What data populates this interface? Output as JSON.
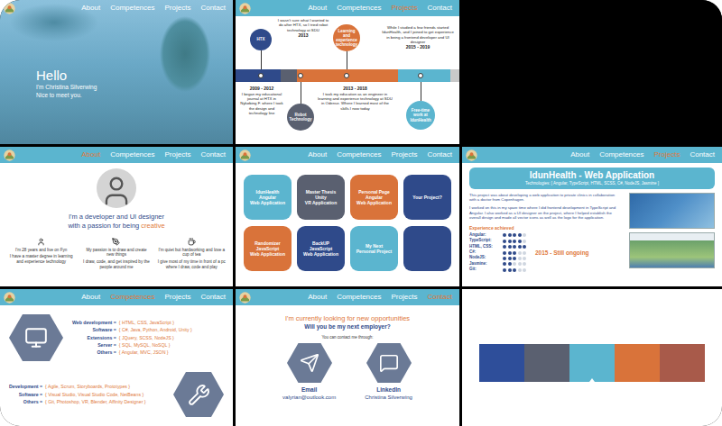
{
  "hero": {
    "nav": [
      {
        "label": "About",
        "selected": false
      },
      {
        "label": "Competences",
        "selected": false
      },
      {
        "label": "Projects",
        "selected": false
      },
      {
        "label": "Contact",
        "selected": false
      }
    ],
    "greeting": "Hello",
    "lines": [
      "I'm Christina Silverwing",
      "Nice to meet you."
    ]
  },
  "timeline": {
    "nav": [
      {
        "label": "About",
        "selected": false
      },
      {
        "label": "Competences",
        "selected": false
      },
      {
        "label": "Projects",
        "selected": true
      },
      {
        "label": "Contact",
        "selected": false
      }
    ],
    "segments": [
      {
        "color": "#2f4a8a"
      },
      {
        "color": "#5a6070"
      },
      {
        "color": "#d9733a"
      },
      {
        "color": "#5bb5cf"
      },
      {
        "color": "#c9c9c9"
      }
    ],
    "events": [
      {
        "kind": "circle",
        "label": "HTX",
        "color": "#2f4a8a"
      },
      {
        "kind": "note",
        "year": "2013",
        "text": "I wasn't sure what I wanted to do after HTX, so I tried robot technology at SDU"
      },
      {
        "kind": "circle",
        "label": "Learning and experience technology",
        "color": "#d9733a"
      },
      {
        "kind": "note",
        "year": "2015 - 2019",
        "text": "While I studied a few friends started IdunHealth, and I joined to get experience in being a frontend developer and UI designer"
      },
      {
        "kind": "note",
        "year": "2009 - 2012",
        "text": "I began my educational journal at HTX in Nykøbing F. where I took the design and technology line"
      },
      {
        "kind": "circle",
        "label": "Robot Technology",
        "color": "#5a6070"
      },
      {
        "kind": "note",
        "year": "2013 - 2018",
        "text": "I took my education as an engineer in learning and experience technology at SDU in Odense. Where I learned most of the skills I now today"
      },
      {
        "kind": "circle",
        "label": "Free-time work at IdunHealth",
        "color": "#5bb5cf"
      }
    ]
  },
  "about": {
    "nav": [
      {
        "label": "About",
        "selected": true
      },
      {
        "label": "Competences",
        "selected": false
      },
      {
        "label": "Projects",
        "selected": false
      },
      {
        "label": "Contact",
        "selected": false
      }
    ],
    "title": "I'm a developer and UI designer",
    "subtitle_prefix": "with a passion for being ",
    "subtitle_highlight": "creative",
    "facts": [
      {
        "headline": "I'm 28 years and live on Fyn",
        "detail": "I have a master degree in learning and experience technology"
      },
      {
        "headline": "My passion is to draw and create new things",
        "detail": "I draw, code, and get inspired by the people around me"
      },
      {
        "headline": "I'm quiet but hardworking and love a cup of tea",
        "detail": "I give most of my time in front of a pc where I draw, code and play"
      }
    ]
  },
  "projects": {
    "nav": [
      {
        "label": "About",
        "selected": false
      },
      {
        "label": "Competences",
        "selected": false
      },
      {
        "label": "Projects",
        "selected": false
      },
      {
        "label": "Contact",
        "selected": false
      }
    ],
    "tiles": [
      {
        "lines": [
          "IdunHealth",
          "Angular",
          "Web Application"
        ],
        "color": "#5bb5cf"
      },
      {
        "lines": [
          "Master Thesis",
          "Unity",
          "VR Application"
        ],
        "color": "#5a6070"
      },
      {
        "lines": [
          "Personal Page",
          "Angular",
          "Web Application"
        ],
        "color": "#d9733a"
      },
      {
        "lines": [
          "Your Project?"
        ],
        "color": "#2f4a8a"
      },
      {
        "lines": [
          "Randomizer",
          "JavaScript",
          "Web Application"
        ],
        "color": "#d9733a"
      },
      {
        "lines": [
          "BackUP",
          "JavaScript",
          "Web Application"
        ],
        "color": "#2f4a8a"
      },
      {
        "lines": [
          "My Next",
          "Personal Project"
        ],
        "color": "#5bb5cf"
      },
      {
        "lines": [],
        "color": "#2f4a8a"
      }
    ]
  },
  "project_detail": {
    "nav": [
      {
        "label": "About",
        "selected": false
      },
      {
        "label": "Competences",
        "selected": false
      },
      {
        "label": "Projects",
        "selected": true
      },
      {
        "label": "Contact",
        "selected": false
      }
    ],
    "title": "IdunHealth - Web Application",
    "technologies": "Technologies: [ Angular, TypeScript, HTML, SCSS, C#, NodeJS, Jasmine ]",
    "paragraphs": [
      "This project was about developing a web application to private clinics in collaboration with a doctor from Copenhagen.",
      "I worked on this in my spare time where I did frontend development in TypeScript and Angular. I also worked as a UI designer on the project, where I helped establish the overall design and made all vector icons as well as the logo for the application."
    ],
    "experience_title": "Experience achieved",
    "skills": [
      {
        "name": "Angular:",
        "stars": 4
      },
      {
        "name": "TypeScript:",
        "stars": 4
      },
      {
        "name": "HTML, CSS:",
        "stars": 5
      },
      {
        "name": "C#:",
        "stars": 3
      },
      {
        "name": "NodeJS:",
        "stars": 3
      },
      {
        "name": "Jasmine:",
        "stars": 2
      },
      {
        "name": "Git:",
        "stars": 3
      }
    ],
    "period": "2015 - Still ongoing"
  },
  "competences": {
    "nav": [
      {
        "label": "About",
        "selected": false
      },
      {
        "label": "Competences",
        "selected": true
      },
      {
        "label": "Projects",
        "selected": false
      },
      {
        "label": "Contact",
        "selected": false
      }
    ],
    "technical": [
      {
        "label": "Web development =",
        "value": "{ HTML, CSS, JavaScript }"
      },
      {
        "label": "Software =",
        "value": "{ C#, Java, Python, Android, Unity }"
      },
      {
        "label": "Extensions =",
        "value": "{ JQuery, SCSS, NodeJS }"
      },
      {
        "label": "Server =",
        "value": "{ SQL, MySQL, NoSQL }"
      },
      {
        "label": "Others =",
        "value": "{ Angular, MVC, JSON }"
      }
    ],
    "general": [
      {
        "label": "Development =",
        "value": "{ Agile, Scrum, Storyboards, Prototypes }"
      },
      {
        "label": "Software =",
        "value": "{ Visual Studio, Visual Studio Code, NetBeans }"
      },
      {
        "label": "Others =",
        "value": "{ Git, Photoshop, VR, Blender, Affinity Designer }"
      }
    ]
  },
  "contact": {
    "nav": [
      {
        "label": "About",
        "selected": false
      },
      {
        "label": "Competences",
        "selected": false
      },
      {
        "label": "Projects",
        "selected": false
      },
      {
        "label": "Contact",
        "selected": true
      }
    ],
    "headline": "I'm currently looking for new opportunities",
    "question": "Will you be my next employer?",
    "hint": "You can contact me through:",
    "channels": [
      {
        "label": "Email",
        "value": "valyrian@outlook.com"
      },
      {
        "label": "LinkedIn",
        "value": "Christina Silverwing"
      }
    ]
  },
  "palette": {
    "swatches": [
      {
        "color": "#2e4e9a",
        "selected": false
      },
      {
        "color": "#5a6070",
        "selected": false
      },
      {
        "color": "#5bb5cf",
        "selected": true
      },
      {
        "color": "#d9733a",
        "selected": false
      },
      {
        "color": "#a85a4a",
        "selected": false
      }
    ]
  }
}
